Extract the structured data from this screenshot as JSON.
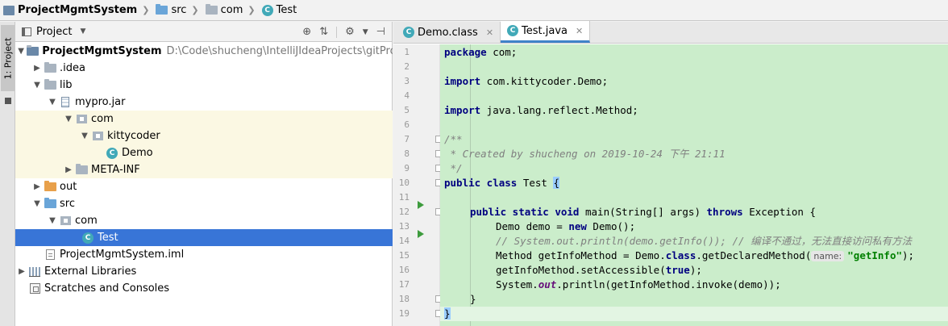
{
  "breadcrumb": {
    "project": "ProjectMgmtSystem",
    "items": [
      "src",
      "com",
      "Test"
    ]
  },
  "toolstrip": {
    "project_tab": "1: Project"
  },
  "project_panel": {
    "title": "Project",
    "tree": [
      {
        "label": "ProjectMgmtSystem",
        "path": "D:\\Code\\shucheng\\IntelliJIdeaProjects\\gitProjects\\P"
      },
      {
        "label": ".idea"
      },
      {
        "label": "lib"
      },
      {
        "label": "mypro.jar"
      },
      {
        "label": "com"
      },
      {
        "label": "kittycoder"
      },
      {
        "label": "Demo"
      },
      {
        "label": "META-INF"
      },
      {
        "label": "out"
      },
      {
        "label": "src"
      },
      {
        "label": "com"
      },
      {
        "label": "Test"
      },
      {
        "label": "ProjectMgmtSystem.iml"
      },
      {
        "label": "External Libraries"
      },
      {
        "label": "Scratches and Consoles"
      }
    ]
  },
  "editor": {
    "tabs": [
      {
        "label": "Demo.class"
      },
      {
        "label": "Test.java"
      }
    ],
    "line_numbers": [
      "1",
      "2",
      "3",
      "4",
      "5",
      "6",
      "7",
      "8",
      "9",
      "10",
      "11",
      "12",
      "13",
      "14",
      "15",
      "16",
      "17",
      "18",
      "19"
    ],
    "code": {
      "l1_kw": "package",
      "l1_rest": " com;",
      "l3_kw": "import",
      "l3_rest": " com.kittycoder.Demo;",
      "l5_kw": "import",
      "l5_rest": " java.lang.reflect.Method;",
      "l7": "/**",
      "l8": " * Created by shucheng on 2019-10-24 下午 21:11",
      "l9": " */",
      "l10_kw": "public class",
      "l10_rest": " Test ",
      "l10_brace": "{",
      "l12_kw1": "public static void",
      "l12_mid": " main(String[] args) ",
      "l12_kw2": "throws",
      "l12_rest": " Exception {",
      "l13_a": "Demo demo = ",
      "l13_kw": "new",
      "l13_b": " Demo();",
      "l14": "// System.out.println(demo.getInfo()); // 编译不通过，无法直接访问私有方法",
      "l15_a": "Method getInfoMethod = Demo.",
      "l15_kw": "class",
      "l15_b": ".getDeclaredMethod(",
      "l15_hint": "name:",
      "l15_str": "\"getInfo\"",
      "l15_c": ");",
      "l16_a": "getInfoMethod.setAccessible(",
      "l16_kw": "true",
      "l16_b": ");",
      "l17_a": "System.",
      "l17_sf": "out",
      "l17_b": ".println(getInfoMethod.invoke(demo));",
      "l18": "}",
      "l19": "}"
    }
  },
  "colors": {
    "selection": "#3875d7",
    "code_bg": "#cbedcb",
    "keyword": "#000080",
    "string": "#008000",
    "comment": "#808080"
  }
}
